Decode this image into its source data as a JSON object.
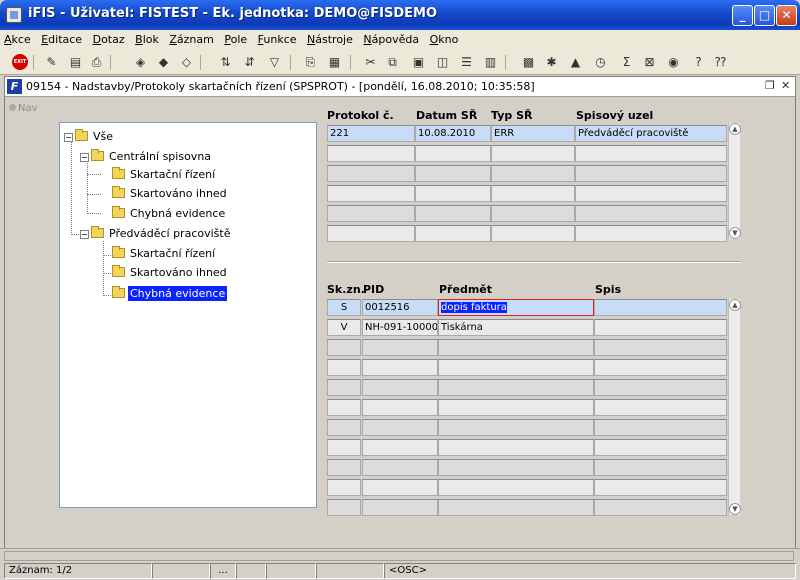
{
  "window": {
    "title": "iFIS - Uživatel: FISTEST - Ek. jednotka: DEMO@FISDEMO"
  },
  "menu": [
    "Akce",
    "Editace",
    "Dotaz",
    "Blok",
    "Záznam",
    "Pole",
    "Funkce",
    "Nástroje",
    "Nápověda",
    "Okno"
  ],
  "toolbar": {
    "exit_label": "EXIT"
  },
  "form": {
    "title": "09154 - Nadstavby/Protokoly skartačních řízení (SPSPROT) - [pondělí, 16.08.2010; 10:35:58]",
    "nav_label": "Nav"
  },
  "tree": {
    "root": "Vše",
    "groups": [
      {
        "label": "Centrální spisovna",
        "items": [
          "Skartační řízení",
          "Skartováno ihned",
          "Chybná evidence"
        ]
      },
      {
        "label": "Předváděcí pracoviště",
        "items": [
          "Skartační řízení",
          "Skartováno ihned",
          "Chybná evidence"
        ]
      }
    ]
  },
  "protocols": {
    "headers": [
      "Protokol č.",
      "Datum SŘ",
      "Typ SŘ",
      "Spisový uzel"
    ],
    "rows": [
      [
        "221",
        "10.08.2010",
        "ERR",
        "Předváděcí pracoviště"
      ],
      [
        "",
        "",
        "",
        ""
      ],
      [
        "",
        "",
        "",
        ""
      ],
      [
        "",
        "",
        "",
        ""
      ],
      [
        "",
        "",
        "",
        ""
      ],
      [
        "",
        "",
        "",
        ""
      ]
    ]
  },
  "documents": {
    "headers": [
      "Sk.zn.",
      "PID",
      "Předmět",
      "Spis"
    ],
    "rows": [
      [
        "S",
        "0012516",
        "dopis faktura",
        ""
      ],
      [
        "V",
        "NH-091-100000",
        "Tiskárna",
        ""
      ],
      [
        "",
        "",
        "",
        ""
      ],
      [
        "",
        "",
        "",
        ""
      ],
      [
        "",
        "",
        "",
        ""
      ],
      [
        "",
        "",
        "",
        ""
      ],
      [
        "",
        "",
        "",
        ""
      ],
      [
        "",
        "",
        "",
        ""
      ],
      [
        "",
        "",
        "",
        ""
      ],
      [
        "",
        "",
        "",
        ""
      ],
      [
        "",
        "",
        "",
        ""
      ]
    ]
  },
  "status": {
    "record": "Záznam: 1/2",
    "dots": "...",
    "mode": "<OSC>"
  }
}
